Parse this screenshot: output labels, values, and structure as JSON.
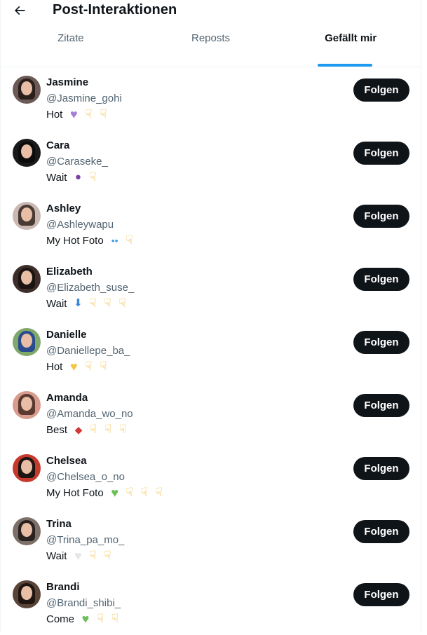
{
  "header": {
    "title": "Post-Interaktionen"
  },
  "tabs": [
    {
      "label": "Zitate",
      "active": false
    },
    {
      "label": "Reposts",
      "active": false
    },
    {
      "label": "Gefällt mir",
      "active": true
    }
  ],
  "colors": {
    "accent": "#1d9bf0",
    "button_bg": "#0f1419",
    "muted": "#536471"
  },
  "users": [
    {
      "name": "Jasmine",
      "handle": "@Jasmine_gohi",
      "bio_text": "Hot",
      "emojis": [
        "purple-heart",
        "point-down",
        "point-down"
      ],
      "follow_label": "Folgen",
      "avatar_color": "#6b5a55",
      "hair_color": "#2b1f1b"
    },
    {
      "name": "Cara",
      "handle": "@Caraseke_",
      "bio_text": "Wait",
      "emojis": [
        "eggplant",
        "point-down"
      ],
      "follow_label": "Folgen",
      "avatar_color": "#1a1a1a",
      "hair_color": "#0b0b0b"
    },
    {
      "name": "Ashley",
      "handle": "@Ashleywapu",
      "bio_text": "My Hot Foto",
      "emojis": [
        "sweat-drops",
        "point-down"
      ],
      "follow_label": "Folgen",
      "avatar_color": "#c9b9b2",
      "hair_color": "#4a3a34"
    },
    {
      "name": "Elizabeth",
      "handle": "@Elizabeth_suse_",
      "bio_text": "Wait",
      "emojis": [
        "down-arrow",
        "point-down",
        "point-down",
        "point-down"
      ],
      "follow_label": "Folgen",
      "avatar_color": "#3d2e2a",
      "hair_color": "#1c1412"
    },
    {
      "name": "Danielle",
      "handle": "@Daniellepe_ba_",
      "bio_text": "Hot",
      "emojis": [
        "yellow-heart",
        "point-down",
        "point-down"
      ],
      "follow_label": "Folgen",
      "avatar_color": "#7fa86a",
      "hair_color": "#2a4b8f"
    },
    {
      "name": "Amanda",
      "handle": "@Amanda_wo_no",
      "bio_text": "Best",
      "emojis": [
        "strawberry",
        "point-down",
        "point-down",
        "point-down"
      ],
      "follow_label": "Folgen",
      "avatar_color": "#d89b8c",
      "hair_color": "#5a3a30"
    },
    {
      "name": "Chelsea",
      "handle": "@Chelsea_o_no",
      "bio_text": "My Hot Foto",
      "emojis": [
        "green-heart",
        "point-down",
        "point-down",
        "point-down"
      ],
      "follow_label": "Folgen",
      "avatar_color": "#c63a2e",
      "hair_color": "#1e1412"
    },
    {
      "name": "Trina",
      "handle": "@Trina_pa_mo_",
      "bio_text": "Wait",
      "emojis": [
        "white-heart",
        "point-down",
        "point-down"
      ],
      "follow_label": "Folgen",
      "avatar_color": "#7d7068",
      "hair_color": "#2a2220"
    },
    {
      "name": "Brandi",
      "handle": "@Brandi_shibi_",
      "bio_text": "Come",
      "emojis": [
        "green-heart",
        "point-down",
        "point-down"
      ],
      "follow_label": "Folgen",
      "avatar_color": "#5a4438",
      "hair_color": "#1f1612"
    }
  ]
}
